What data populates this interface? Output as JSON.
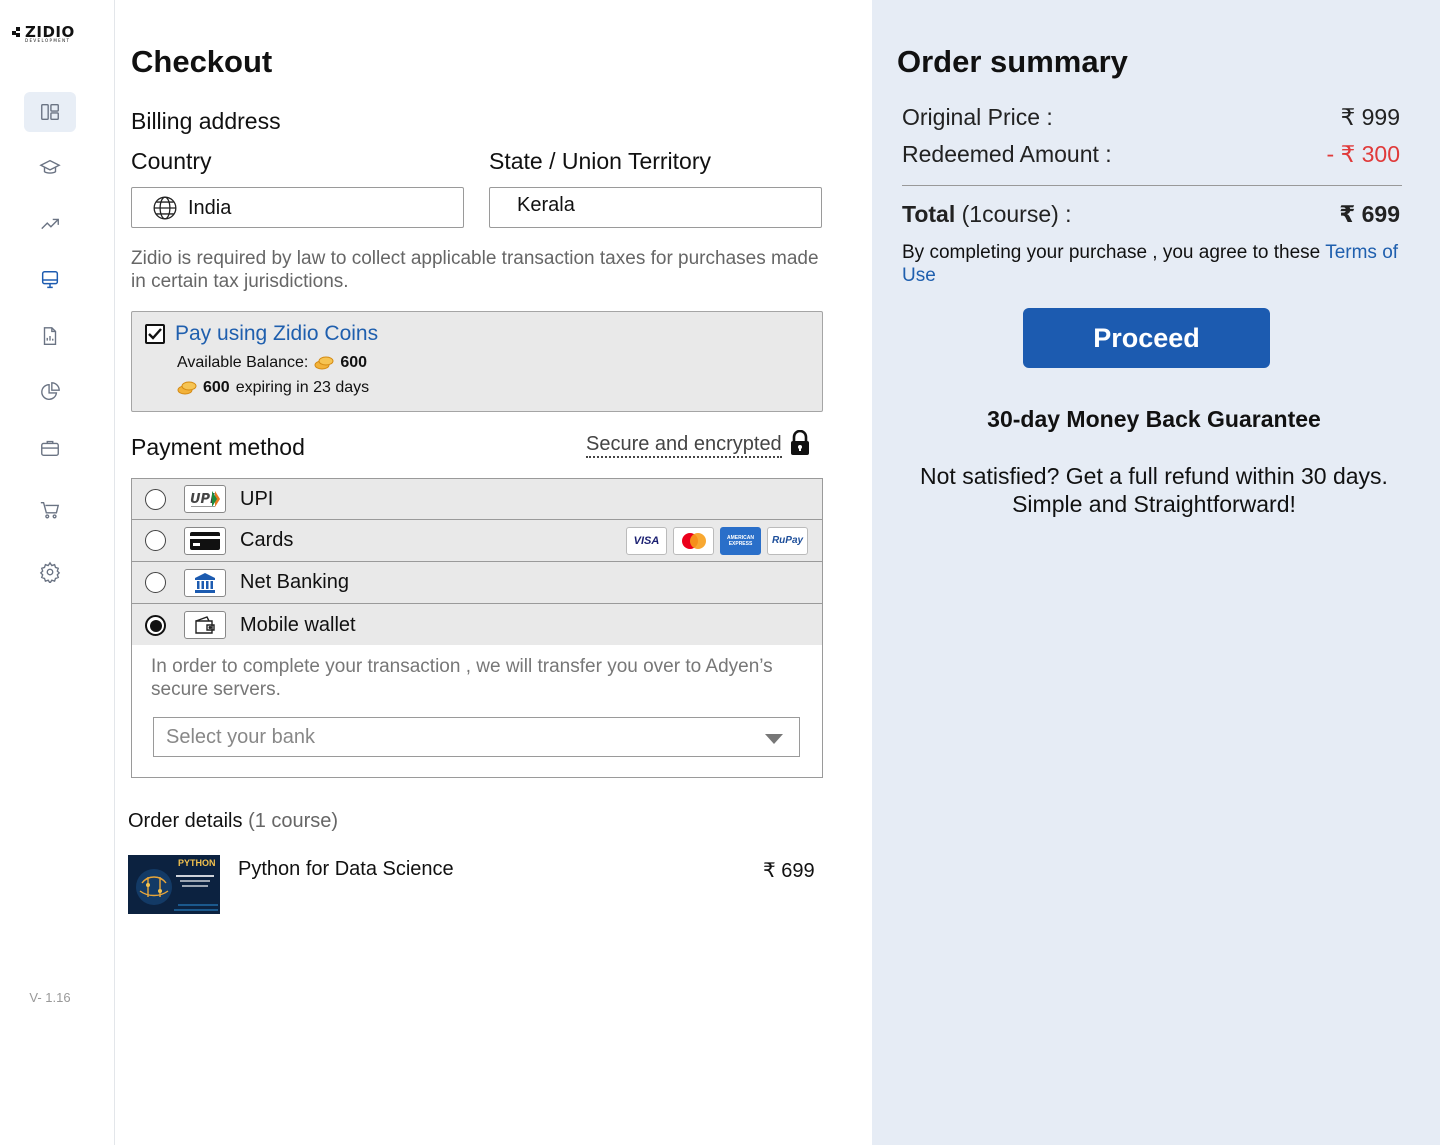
{
  "brand": {
    "name": "ZIDIO",
    "tagline": "DEVELOPMENT"
  },
  "sidebar": {
    "items": [
      {
        "icon": "dashboard-icon",
        "active": true
      },
      {
        "icon": "graduation-cap-icon",
        "active": false
      },
      {
        "icon": "trending-up-icon",
        "active": false
      },
      {
        "icon": "monitor-icon",
        "active": false,
        "highlight": true
      },
      {
        "icon": "report-file-icon",
        "active": false
      },
      {
        "icon": "pie-chart-icon",
        "active": false
      },
      {
        "icon": "briefcase-icon",
        "active": false
      },
      {
        "icon": "cart-icon",
        "active": false
      },
      {
        "icon": "settings-gear-icon",
        "active": false
      }
    ],
    "version": "V- 1.16"
  },
  "checkout": {
    "title": "Checkout",
    "billing_title": "Billing address",
    "country_label": "Country",
    "country_value": "India",
    "state_label": "State / Union Territory",
    "state_value": "Kerala",
    "tax_note": "Zidio is required by law to collect applicable transaction taxes for purchases made in certain tax jurisdictions."
  },
  "coins": {
    "checked": true,
    "title": "Pay using Zidio Coins",
    "balance_label": "Available Balance:",
    "balance_value": "600",
    "expiring_value": "600",
    "expiring_label": "expiring in 23 days"
  },
  "payment": {
    "title": "Payment method",
    "secure_label": "Secure and encrypted",
    "methods": [
      {
        "label": "UPI",
        "icon": "upi-icon",
        "selected": false
      },
      {
        "label": "Cards",
        "icon": "credit-card-icon",
        "selected": false
      },
      {
        "label": "Net Banking",
        "icon": "bank-icon",
        "selected": false
      },
      {
        "label": "Mobile wallet",
        "icon": "wallet-icon",
        "selected": true
      }
    ],
    "card_brands": [
      "VISA",
      "Mastercard",
      "AMERICAN EXPRESS",
      "RuPay"
    ],
    "wallet_note": "In order to complete your transaction , we will transfer you over to Adyen’s secure servers.",
    "bank_placeholder": "Select your bank"
  },
  "order": {
    "title": "Order details",
    "count": "(1 course)",
    "course_title": "Python for Data Science",
    "course_price": "₹ 699",
    "thumb_text": "PYTHON"
  },
  "summary": {
    "title": "Order summary",
    "original_label": "Original Price :",
    "original_value": "₹ 999",
    "redeemed_label": "Redeemed Amount :",
    "redeemed_value": "- ₹ 300",
    "total_label": "Total",
    "total_count": "(1course) :",
    "total_value": "₹ 699",
    "agree_text": "By completing your purchase , you agree to these ",
    "terms_link": "Terms of Use",
    "proceed_label": "Proceed",
    "guarantee_title": "30-day Money Back Guarantee",
    "guarantee_line1": "Not satisfied? Get a full refund within 30 days.",
    "guarantee_line2": "Simple and Straightforward!"
  },
  "colors": {
    "accent": "#1c5bb0",
    "link": "#1f5fae",
    "danger": "#e03a3a",
    "summary_bg": "#e6ecf5"
  }
}
